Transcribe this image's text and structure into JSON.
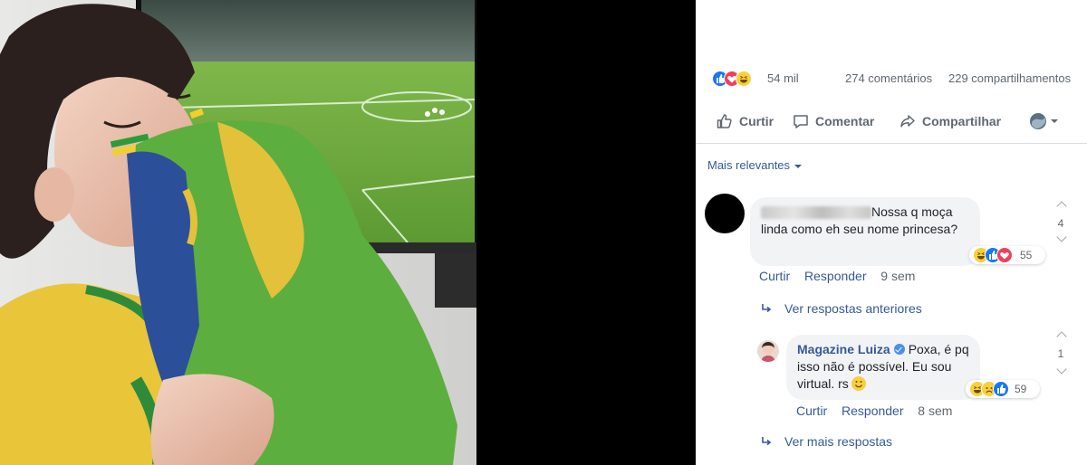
{
  "post": {
    "reaction_count": "54 mil",
    "comments": "274 comentários",
    "shares": "229 compartilhamentos",
    "reaction_types": [
      "like",
      "love",
      "haha"
    ],
    "actions": {
      "like": "Curtir",
      "comment": "Comentar",
      "share": "Compartilhar"
    },
    "sort_label": "Mais relevantes"
  },
  "comments": [
    {
      "text": "Nossa q moça linda como eh seu nome princesa?",
      "reaction_count": "55",
      "reaction_types": [
        "haha",
        "like",
        "love"
      ],
      "like_label": "Curtir",
      "reply_label": "Responder",
      "time": "9 sem",
      "side_count": "4",
      "previous_replies": "Ver respostas anteriores",
      "reply": {
        "author": "Magazine Luiza",
        "text": "Poxa, é pq isso não é possível. Eu sou virtual. rs",
        "reaction_count": "59",
        "reaction_types": [
          "haha",
          "sad",
          "like"
        ],
        "like_label": "Curtir",
        "reply_label": "Responder",
        "time": "8 sem",
        "side_count": "1"
      },
      "more_replies": "Ver mais respostas"
    }
  ],
  "colors": {
    "link": "#385898",
    "secondary_text": "#606770",
    "bubble": "#f2f3f5",
    "like": "#1877f2",
    "love": "#f33e58",
    "haha": "#f7d03c"
  }
}
